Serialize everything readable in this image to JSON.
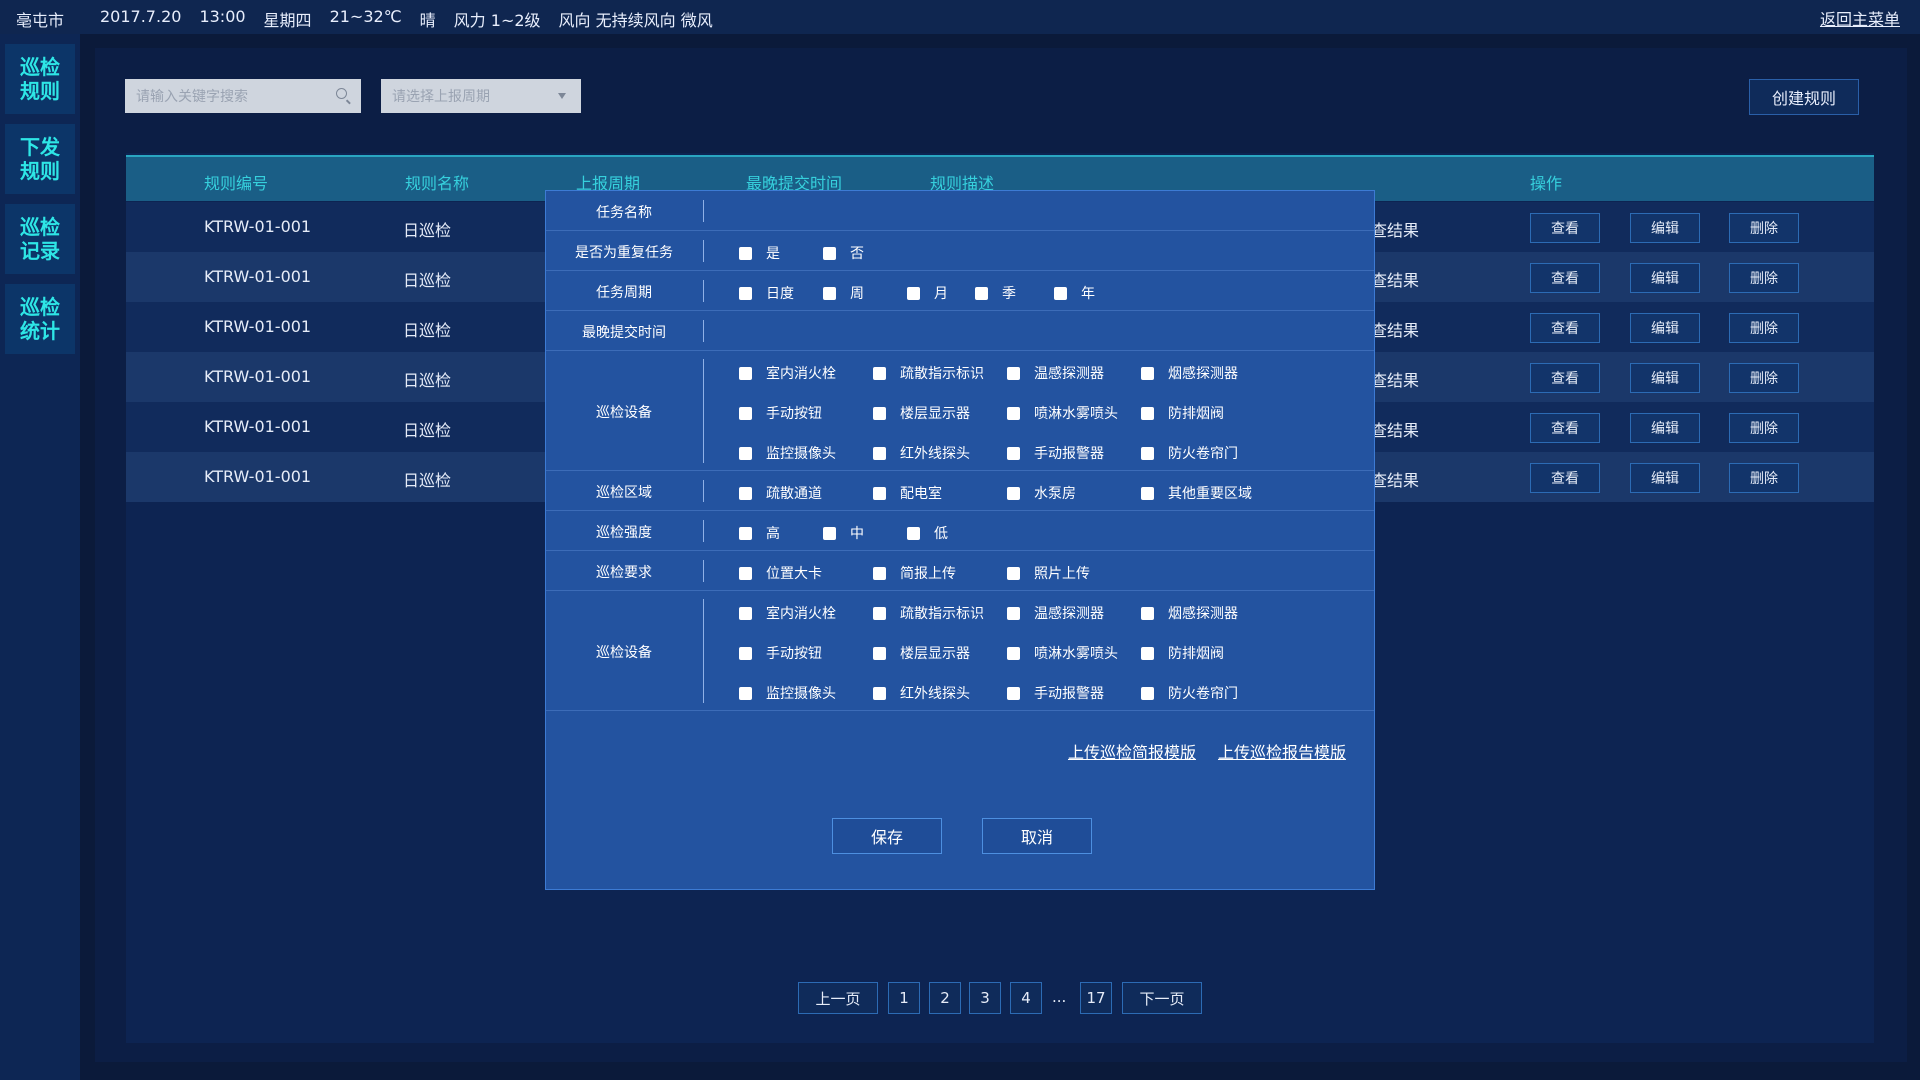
{
  "topbar": {
    "city": "亳屯市",
    "date": "2017.7.20",
    "time": "13:00",
    "weekday": "星期四",
    "temp": "21~32℃",
    "weather": "晴",
    "wind_force": "风力 1~2级",
    "wind_dir": "风向 无持续风向 微风",
    "back": "返回主菜单"
  },
  "sidebar": {
    "items": [
      {
        "label": "巡检规则"
      },
      {
        "label": "下发规则"
      },
      {
        "label": "巡检记录"
      },
      {
        "label": "巡检统计"
      }
    ]
  },
  "toolbar": {
    "search_placeholder": "请输入关键字搜索",
    "select_placeholder": "请选择上报周期",
    "create": "创建规则"
  },
  "table": {
    "headers": [
      "规则编号",
      "规则名称",
      "上报周期",
      "最晚提交时间",
      "规则描述",
      "操作"
    ],
    "rows": [
      {
        "id": "KTRW-01-001",
        "name": "日巡检",
        "desc": "查结果"
      },
      {
        "id": "KTRW-01-001",
        "name": "日巡检",
        "desc": "查结果"
      },
      {
        "id": "KTRW-01-001",
        "name": "日巡检",
        "desc": "查结果"
      },
      {
        "id": "KTRW-01-001",
        "name": "日巡检",
        "desc": "查结果"
      },
      {
        "id": "KTRW-01-001",
        "name": "日巡检",
        "desc": "查结果"
      },
      {
        "id": "KTRW-01-001",
        "name": "日巡检",
        "desc": "查结果"
      }
    ],
    "ops": {
      "view": "查看",
      "edit": "编辑",
      "delete": "删除"
    }
  },
  "pager": {
    "prev": "上一页",
    "pages": [
      "1",
      "2",
      "3",
      "4"
    ],
    "dots": "...",
    "last": "17",
    "next": "下一页"
  },
  "modal": {
    "task_name": "任务名称",
    "repeat": {
      "label": "是否为重复任务",
      "options": [
        "是",
        "否"
      ]
    },
    "period": {
      "label": "任务周期",
      "options": [
        "日度",
        "周",
        "月",
        "季",
        "年"
      ]
    },
    "deadline": "最晚提交时间",
    "devices1": {
      "label": "巡检设备",
      "options": [
        "室内消火栓",
        "疏散指示标识",
        "温感探测器",
        "烟感探测器",
        "手动按钮",
        "楼层显示器",
        "喷淋水雾喷头",
        "防排烟阀",
        "监控摄像头",
        "红外线探头",
        "手动报警器",
        "防火卷帘门"
      ]
    },
    "areas": {
      "label": "巡检区域",
      "options": [
        "疏散通道",
        "配电室",
        "水泵房",
        "其他重要区域"
      ]
    },
    "intensity": {
      "label": "巡检强度",
      "options": [
        "高",
        "中",
        "低"
      ]
    },
    "requirements": {
      "label": "巡检要求",
      "options": [
        "位置大卡",
        "简报上传",
        "照片上传"
      ]
    },
    "devices2": {
      "label": "巡检设备",
      "options": [
        "室内消火栓",
        "疏散指示标识",
        "温感探测器",
        "烟感探测器",
        "手动按钮",
        "楼层显示器",
        "喷淋水雾喷头",
        "防排烟阀",
        "监控摄像头",
        "红外线探头",
        "手动报警器",
        "防火卷帘门"
      ]
    },
    "upload_brief": "上传巡检简报模版",
    "upload_report": "上传巡检报告模版",
    "save": "保存",
    "cancel": "取消"
  }
}
